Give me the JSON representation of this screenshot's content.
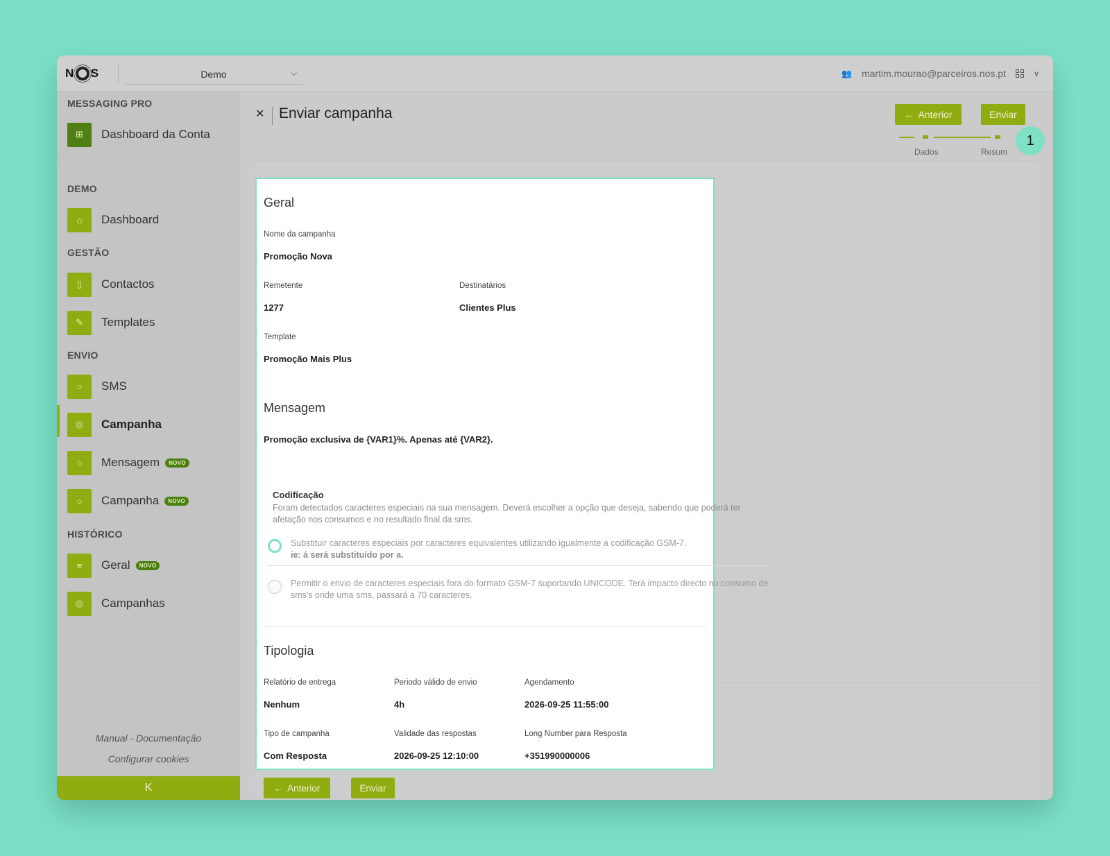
{
  "topbar": {
    "logo_left": "N",
    "logo_right": "S",
    "account_select_value": "Demo",
    "user_email": "martim.mourao@parceiros.nos.pt"
  },
  "sidebar": {
    "sections": {
      "messaging_pro": "MESSAGING PRO",
      "demo": "DEMO",
      "gestao": "GESTÃO",
      "envio": "ENVIO",
      "historico": "HISTÓRICO"
    },
    "items": {
      "dashboard_conta": "Dashboard da Conta",
      "dashboard": "Dashboard",
      "contactos": "Contactos",
      "templates": "Templates",
      "sms": "SMS",
      "campanha": "Campanha",
      "mensagem": "Mensagem",
      "campanha_novo": "Campanha",
      "geral": "Geral",
      "campanhas": "Campanhas"
    },
    "badge_novo": "NOVO",
    "footer": {
      "manual": "Manual - Documentação",
      "cookies": "Configurar cookies"
    },
    "collapse_glyph": "K"
  },
  "header": {
    "title": "Enviar campanha",
    "btn_anterior": "Anterior",
    "btn_enviar": "Enviar",
    "steps": [
      "Dados",
      "Resum"
    ],
    "callout_number": "1"
  },
  "summary": {
    "geral_title": "Geral",
    "nome_label": "Nome da campanha",
    "nome_value": "Promoção Nova",
    "remetente_label": "Remetente",
    "remetente_value": "1277",
    "destinatarios_label": "Destinatários",
    "destinatarios_value": "Clientes Plus",
    "template_label": "Template",
    "template_value": "Promoção Mais Plus",
    "mensagem_title": "Mensagem",
    "mensagem_text": "Promoção exclusiva de {VAR1}%. Apenas até {VAR2}.",
    "tipologia_title": "Tipologia",
    "relatorio_label": "Relatório de entrega",
    "relatorio_value": "Nenhum",
    "periodo_label": "Periodo válido de envio",
    "periodo_value": "4h",
    "agendamento_label": "Agendamento",
    "agendamento_value": "2026-09-25 11:55:00",
    "tipo_label": "Tipo de campanha",
    "tipo_value": "Com Resposta",
    "validade_label": "Validade das respostas",
    "validade_value": "2026-09-25 12:10:00",
    "long_label": "Long Number para Resposta",
    "long_value": "+351990000006"
  },
  "codificacao": {
    "title": "Codificação",
    "description": "Foram detectados caracteres especiais na sua mensagem. Deverá escolher a opção que deseja, sabendo que poderá ter afetação nos consumos e no resultado final da sms.",
    "option1_line1": "Substituir caracteres especiais por caracteres equivalentes utilizando igualmente a codificação GSM-7.",
    "option1_line2": "ie: á será substituído por a.",
    "option2": "Permitir o envio de caracteres especiais fora do formato GSM-7 suportando UNICODE. Terá impacto directo no consumo de sms's onde uma sms, passará a 70 caracteres."
  },
  "footer_buttons": {
    "anterior": "Anterior",
    "enviar": "Enviar"
  },
  "colors": {
    "brand_green": "#8fac11",
    "badge_green": "#4b7f0f",
    "highlight_teal": "#7fe0c5",
    "background_teal": "#7adfc6"
  }
}
